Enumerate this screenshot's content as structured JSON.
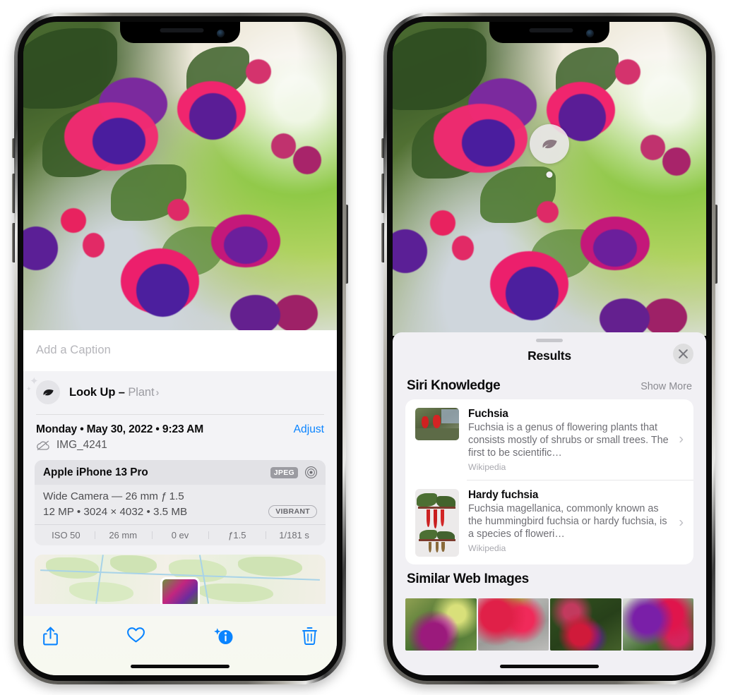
{
  "left_phone": {
    "photo": {
      "alt": "fuchsia-flowers-photo"
    },
    "caption_placeholder": "Add a Caption",
    "lookup": {
      "icon": "leaf-icon",
      "sparkle_icon": "sparkle-icon",
      "label": "Look Up – ",
      "subject": "Plant",
      "chevron": "›"
    },
    "meta": {
      "date": "Monday • May 30, 2022 • 9:23 AM",
      "adjust_label": "Adjust",
      "cloud_icon": "cloud-slash-icon",
      "filename": "IMG_4241"
    },
    "camera": {
      "model": "Apple iPhone 13 Pro",
      "format_badge": "JPEG",
      "aperture_icon": "aperture-icon",
      "lens_line": "Wide Camera — 26 mm ƒ 1.5",
      "size_line": "12 MP • 3024 × 4032 • 3.5 MB",
      "style_badge": "VIBRANT",
      "exif": [
        "ISO 50",
        "26 mm",
        "0 ev",
        "ƒ1.5",
        "1/181 s"
      ]
    },
    "map": {
      "thumb_label": "map-photo-thumbnail"
    },
    "toolbar": [
      {
        "name": "share-icon",
        "label": "Share"
      },
      {
        "name": "heart-icon",
        "label": "Favorite"
      },
      {
        "name": "info-icon",
        "label": "Info"
      },
      {
        "name": "trash-icon",
        "label": "Delete"
      }
    ],
    "accent_color": "#0a84ff"
  },
  "right_phone": {
    "visual_lookup_badge": {
      "icon": "leaf-icon"
    },
    "sheet": {
      "title": "Results",
      "close_icon": "close-icon",
      "sections": [
        {
          "title": "Siri Knowledge",
          "action": "Show More",
          "items": [
            {
              "title": "Fuchsia",
              "description": "Fuchsia is a genus of flowering plants that consists mostly of shrubs or small trees. The first to be scientific…",
              "source": "Wikipedia",
              "thumb": "fuchsia-thumbnail",
              "chevron": "›"
            },
            {
              "title": "Hardy fuchsia",
              "description": "Fuchsia magellanica, commonly known as the hummingbird fuchsia or hardy fuchsia, is a species of floweri…",
              "source": "Wikipedia",
              "thumb": "hardy-fuchsia-thumbnail",
              "chevron": "›"
            }
          ]
        },
        {
          "title": "Similar Web Images",
          "images": [
            "similar-image-1",
            "similar-image-2",
            "similar-image-3",
            "similar-image-4"
          ]
        }
      ]
    }
  }
}
